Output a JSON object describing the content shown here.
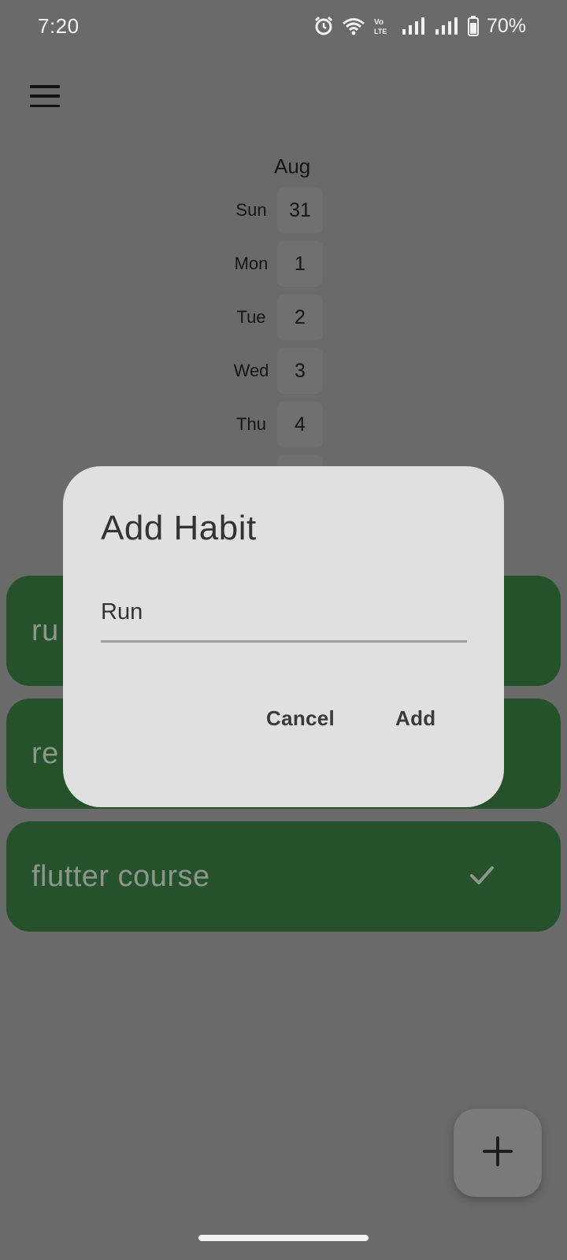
{
  "status_bar": {
    "time": "7:20",
    "battery": "70%",
    "icons": [
      "alarm-icon",
      "wifi-icon",
      "volte-icon",
      "signal-icon",
      "signal-icon",
      "battery-icon"
    ]
  },
  "header": {
    "menu_icon": "hamburger-menu-icon"
  },
  "calendar": {
    "month": "Aug",
    "days": [
      {
        "day": "Sun",
        "date": "31"
      },
      {
        "day": "Mon",
        "date": "1"
      },
      {
        "day": "Tue",
        "date": "2"
      },
      {
        "day": "Wed",
        "date": "3"
      },
      {
        "day": "Thu",
        "date": "4"
      }
    ]
  },
  "habits": [
    {
      "name": "ru",
      "completed": false
    },
    {
      "name": "re",
      "completed": false
    },
    {
      "name": "flutter course",
      "completed": true
    }
  ],
  "dialog": {
    "title": "Add Habit",
    "input_value": "Run",
    "cancel_label": "Cancel",
    "add_label": "Add"
  },
  "fab": {
    "icon": "plus-icon"
  },
  "colors": {
    "scrim_background": "#6a6a6a",
    "habit_tile": "#25522a",
    "dialog_background": "#e0e0e0"
  }
}
